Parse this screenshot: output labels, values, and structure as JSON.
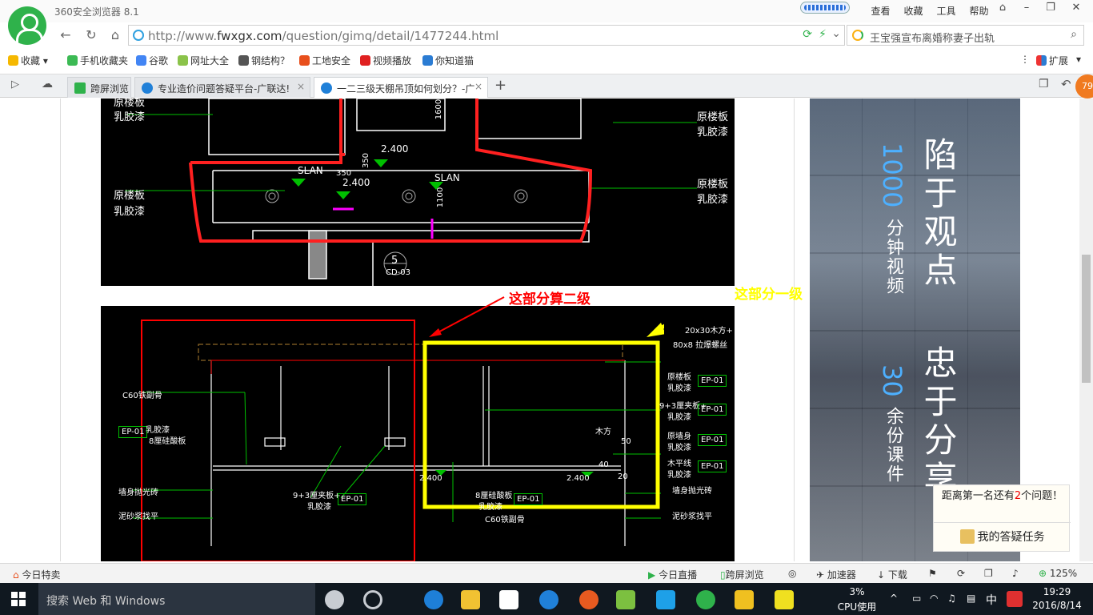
{
  "window": {
    "app_title": "360安全浏览器 8.1",
    "menu": [
      "查看",
      "收藏",
      "工具",
      "帮助"
    ]
  },
  "address": {
    "url_prefix": "http://www.",
    "url_domain": "fwxgx.com",
    "url_path": "/question/gimq/detail/1477244.html",
    "search_text": "王宝强宣布离婚称妻子出轨"
  },
  "bookmarks": [
    "收藏",
    "手机收藏夹",
    "谷歌",
    "网址大全",
    "钢结构？",
    "工地安全",
    "视频播放",
    "你知道猫"
  ],
  "bookmarks_extension": "扩展",
  "tabs": [
    {
      "label": "跨屏浏览"
    },
    {
      "label": "专业造价问题答疑平台-广联达!"
    },
    {
      "label": "一二三级天棚吊顶如何划分？-广"
    }
  ],
  "cad_top": {
    "labels": {
      "a1": "原楼板",
      "a2": "乳胶漆",
      "b1": "原楼板",
      "b2": "乳胶漆",
      "c1": "原楼板",
      "c2": "乳胶漆",
      "d1": "原楼板",
      "d2": "乳胶漆",
      "slan1": "SLAN",
      "slan2": "SLAN",
      "elev1": "2.400",
      "elev2": "2.400",
      "dim1": "1600",
      "dim2": "350",
      "dim3": "350",
      "dim4": "1100",
      "marker_num": "5",
      "marker_ref": "CD-03"
    }
  },
  "annotations": {
    "red": "这部分算二级",
    "yellow": "这部分一级"
  },
  "cad_bottom": {
    "labels": {
      "l1": "C60铁副骨",
      "ep1": "EP-01",
      "l2": "乳胶漆",
      "l3": "8厘硅酸板",
      "l4": "墙身抛光砖",
      "l5": "泥砂浆找平",
      "l6": "9+3厘夹板+",
      "l7": "乳胶漆",
      "ep2": "EP-01",
      "e1": "2.400",
      "e2": "2.400",
      "l8": "8厘硅酸板",
      "l9": "乳胶漆",
      "ep3": "EP-01",
      "l10": "C60铁副骨",
      "r1": "20x30木方+",
      "r2": "80x8 拉爆螺丝",
      "r3": "原楼板",
      "r4": "乳胶漆",
      "r5": "9+3厘夹板+",
      "r6": "乳胶漆",
      "r7": "原墙身",
      "r8": "乳胶漆",
      "r9": "木平线",
      "r10": "乳胶漆",
      "r11": "墙身抛光砖",
      "r12": "泥砂浆找平",
      "mf": "木方",
      "d50": "50",
      "d40": "40",
      "d20": "20",
      "ep_r": [
        "EP-01",
        "EP-01",
        "EP-01",
        "EP-01"
      ]
    }
  },
  "ad": {
    "big1": "陷于观点",
    "big2": "忠于分享",
    "blue1": "1000",
    "sub1": "分钟视频",
    "blue2": "30",
    "sub2": "余份课件"
  },
  "task_popup": {
    "msg_before": "距离第一名还有",
    "msg_count": "2",
    "msg_after": "个问题！",
    "button": "我的答疑任务"
  },
  "statusbar": {
    "left": "今日特卖",
    "items": [
      "今日直播",
      "跨屏浏览",
      "加速器",
      "下载"
    ],
    "zoom": "125%"
  },
  "taskbar": {
    "search_placeholder": "搜索 Web 和 Windows",
    "cpu_percent": "3%",
    "cpu_label": "CPU使用",
    "ime": "中",
    "time": "19:29",
    "date": "2016/8/14"
  },
  "badge_count": "79",
  "colors": {
    "cad_background": "#000000",
    "annotation_red": "#ff0000",
    "annotation_yellow": "#ffff00",
    "brand_green": "#2fb24b"
  }
}
